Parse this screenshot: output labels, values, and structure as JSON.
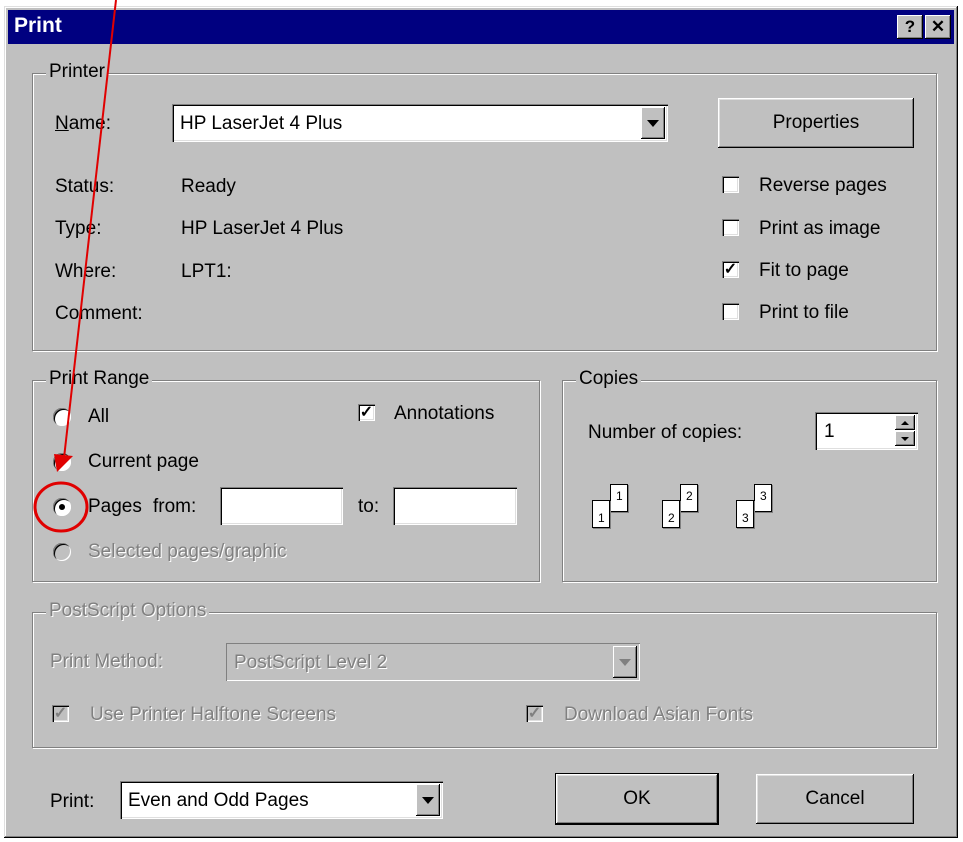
{
  "window": {
    "title": "Print",
    "help_glyph": "?",
    "close_glyph": "✕"
  },
  "printer": {
    "legend": "Printer",
    "name_label": "Name:",
    "name_value": "HP LaserJet 4 Plus",
    "status_label": "Status:",
    "status_value": "Ready",
    "type_label": "Type:",
    "type_value": "HP LaserJet 4 Plus",
    "where_label": "Where:",
    "where_value": "LPT1:",
    "comment_label": "Comment:",
    "properties_button": "Properties",
    "options": [
      {
        "label": "Reverse pages",
        "checked": false
      },
      {
        "label": "Print as image",
        "checked": false
      },
      {
        "label": "Fit to page",
        "checked": true
      },
      {
        "label": "Print to file",
        "checked": false
      }
    ]
  },
  "print_range": {
    "legend": "Print Range",
    "all_label": "All",
    "current_label": "Current page",
    "pages_label": "Pages",
    "from_label": "from:",
    "to_label": "to:",
    "from_value": "",
    "to_value": "",
    "selected_label": "Selected pages/graphic",
    "selected_option": "Pages",
    "annotations_label": "Annotations",
    "annotations_checked": true
  },
  "copies": {
    "legend": "Copies",
    "number_label": "Number of copies:",
    "number_value": "1",
    "collate_icons": [
      {
        "front": "1",
        "back": "1"
      },
      {
        "front": "2",
        "back": "2"
      },
      {
        "front": "3",
        "back": "3"
      }
    ]
  },
  "postscript": {
    "legend": "PostScript Options",
    "method_label": "Print Method:",
    "method_value": "PostScript Level 2",
    "halftone_label": "Use Printer Halftone Screens",
    "asian_fonts_label": "Download Asian Fonts"
  },
  "footer": {
    "print_label": "Print:",
    "print_value": "Even and Odd Pages",
    "ok_button": "OK",
    "cancel_button": "Cancel"
  },
  "colors": {
    "face": "#c0c0c0",
    "titlebar": "#000080",
    "annotation": "#e00000"
  }
}
